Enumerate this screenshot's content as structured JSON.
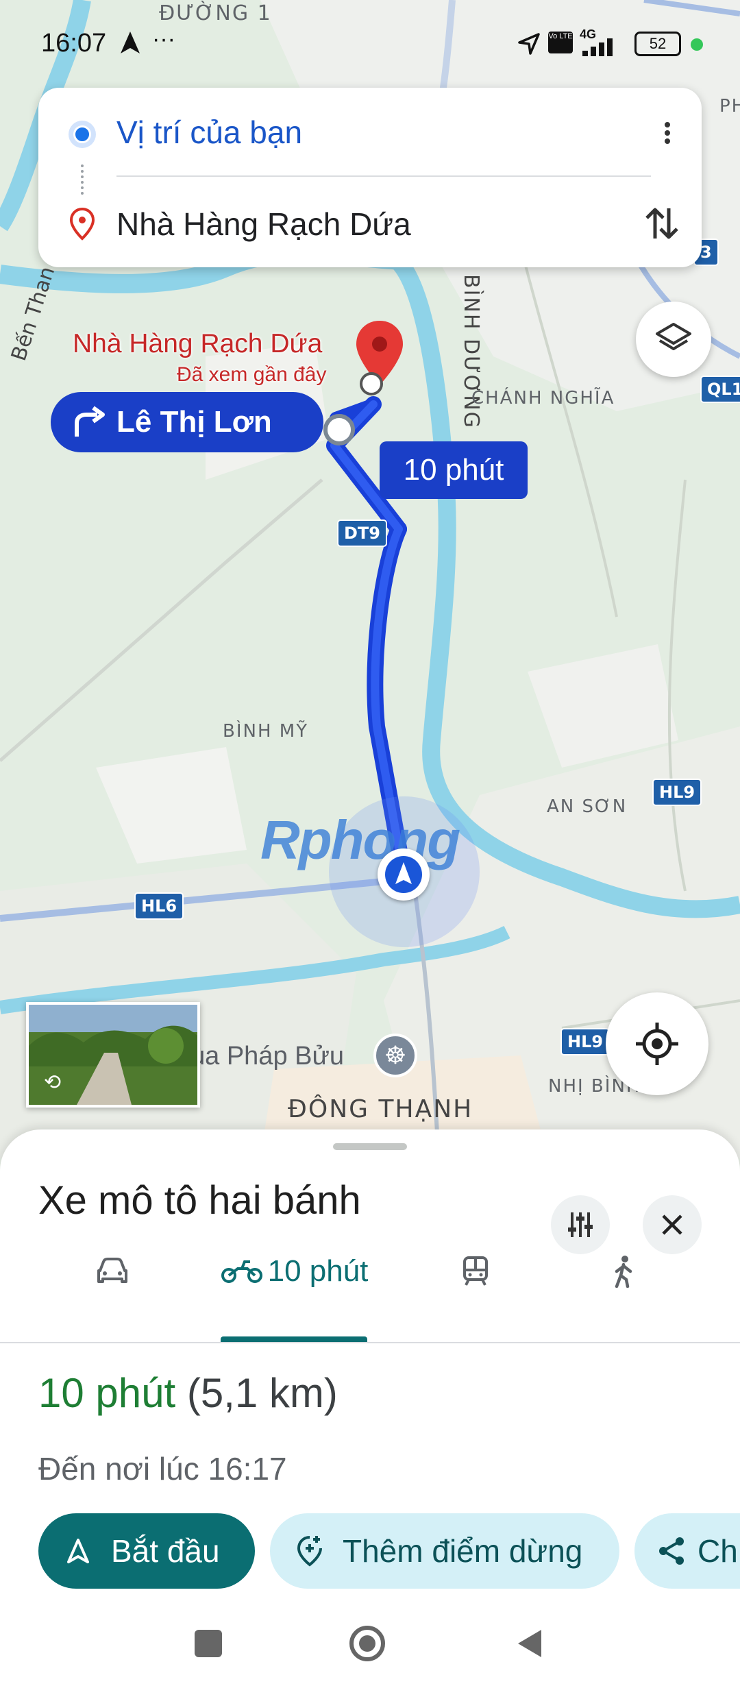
{
  "status_bar": {
    "time": "16:07",
    "more": "···",
    "network": "4G",
    "volte": "Vo LTE",
    "battery": "52"
  },
  "search": {
    "origin": "Vị trí của bạn",
    "destination": "Nhà Hàng Rạch Dứa"
  },
  "map": {
    "labels": {
      "duong1": "ĐƯỜNG 1",
      "ben_than": "Bến Than",
      "binh_duong": "BÌNH DƯƠNG",
      "chanh_nghia": "CHÁNH NGHĨA",
      "binh_my": "BÌNH MỸ",
      "an_son": "AN SƠN",
      "dong_thanh": "ĐÔNG THẠNH",
      "nhi_binh": "NHỊ BÌNH",
      "chua_phap_buu": "ùa Pháp Bửu",
      "ph": "PH"
    },
    "road_tags": {
      "dt9": "DT9",
      "hl9_a": "HL9",
      "hl9_b": "HL9",
      "hl6": "HL6",
      "ql1": "QL1",
      "edge_3": "3"
    },
    "destination_label": "Nhà Hàng Rạch Dứa",
    "destination_sub": "Đã xem gần đây",
    "turn_callout": "Lê Thị Lơn",
    "eta_callout": "10 phút",
    "watermark": "Rphong"
  },
  "sheet": {
    "title": "Xe mô tô hai bánh",
    "modes": [
      {
        "name": "car",
        "label": ""
      },
      {
        "name": "motorbike",
        "label": "10 phút"
      },
      {
        "name": "transit",
        "label": ""
      },
      {
        "name": "walk",
        "label": ""
      }
    ],
    "duration": "10 phút",
    "distance": "(5,1 km)",
    "arrival": "Đến nơi lúc 16:17",
    "start_button": "Bắt đầu",
    "add_stop_button": "Thêm điểm dừng",
    "share_button": "Ch"
  },
  "colors": {
    "route": "#1a3fe0",
    "accent": "#0b6e72",
    "duration_green": "#1e7e34",
    "pin_red": "#e53935",
    "link_blue": "#1a56c8"
  }
}
